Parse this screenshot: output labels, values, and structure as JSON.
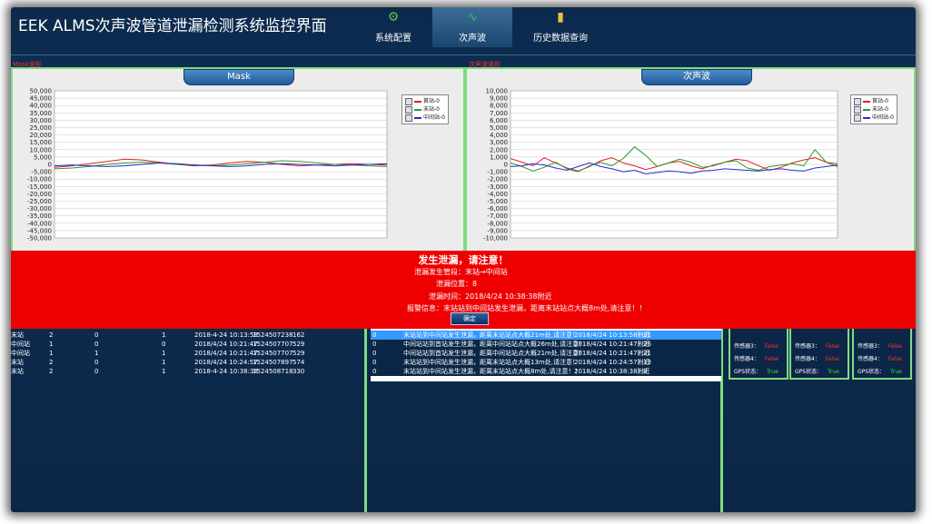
{
  "app": {
    "title": "EEK ALMS次声波管道泄漏检测系统监控界面"
  },
  "nav": [
    {
      "label": "系统配置",
      "icon": "gear-icon",
      "glyph": "⚙",
      "color": "#5bc24a",
      "active": false
    },
    {
      "label": "次声波",
      "icon": "waveform-icon",
      "glyph": "∿",
      "color": "#49b36a",
      "active": true
    },
    {
      "label": "历史数据查询",
      "icon": "database-icon",
      "glyph": "▮",
      "color": "#e8c33b",
      "active": false
    }
  ],
  "left_panel": {
    "section_label": "Mask波形",
    "tab": "Mask"
  },
  "right_panel": {
    "section_label": "次声波波形",
    "tab": "次声波"
  },
  "legend": [
    "首站-0",
    "末站-0",
    "中间站-0"
  ],
  "colors": {
    "series1": "#e02020",
    "series2": "#2b9b2b",
    "series3": "#2a2acd",
    "alarm": "#ee0000",
    "accent": "#7fdc7f"
  },
  "chart_data": [
    {
      "type": "line",
      "title": "Mask",
      "ylim": [
        -50000,
        50000
      ],
      "yticks": [
        "50,000",
        "45,000",
        "40,000",
        "35,000",
        "30,000",
        "25,000",
        "20,000",
        "15,000",
        "10,000",
        "5,000",
        "0",
        "-5,000",
        "-10,000",
        "-15,000",
        "-20,000",
        "-25,000",
        "-30,000",
        "-35,000",
        "-40,000",
        "-45,000",
        "-50,000"
      ],
      "grid": true,
      "legend_position": "top-right",
      "series": [
        {
          "name": "首站-0",
          "values": [
            -2000,
            -1000,
            500,
            2000,
            3500,
            3000,
            1500,
            0,
            -1000,
            -500,
            1000,
            2000,
            1500,
            0,
            -1000,
            -500,
            0,
            500,
            0,
            -500
          ]
        },
        {
          "name": "末站-0",
          "values": [
            -3000,
            -2500,
            -1500,
            0,
            1000,
            1500,
            1000,
            0,
            -500,
            -1000,
            -500,
            500,
            1500,
            2500,
            2000,
            1000,
            0,
            -500,
            -1000,
            -1500
          ]
        },
        {
          "name": "中间站-0",
          "values": [
            -1000,
            -500,
            -1000,
            -1500,
            -1000,
            0,
            1000,
            500,
            -500,
            -1000,
            -1500,
            -1000,
            0,
            500,
            0,
            -500,
            -1000,
            -500,
            0,
            500
          ]
        }
      ]
    },
    {
      "type": "line",
      "title": "次声波",
      "ylim": [
        -10000,
        10000
      ],
      "yticks": [
        "10,000",
        "9,000",
        "8,000",
        "7,000",
        "6,000",
        "5,000",
        "4,000",
        "3,000",
        "2,000",
        "1,000",
        "0",
        "-1,000",
        "-2,000",
        "-3,000",
        "-4,000",
        "-5,000",
        "-6,000",
        "-7,000",
        "-8,000",
        "-9,000",
        "-10,000"
      ],
      "grid": true,
      "legend_position": "top-right",
      "series": [
        {
          "name": "首站-0",
          "values": [
            800,
            300,
            -200,
            900,
            200,
            -500,
            -900,
            -300,
            500,
            900,
            200,
            -200,
            -700,
            -300,
            200,
            400,
            -200,
            -600,
            -100,
            300,
            700,
            500,
            -200,
            -800,
            -400,
            200,
            600,
            900,
            300,
            -300
          ]
        },
        {
          "name": "末站-0",
          "values": [
            200,
            -300,
            -900,
            -400,
            300,
            -600,
            -1000,
            -200,
            300,
            -200,
            800,
            2400,
            1200,
            -300,
            200,
            700,
            300,
            -400,
            -200,
            300,
            500,
            -500,
            -800,
            -300,
            -100,
            100,
            -200,
            2000,
            300,
            100
          ]
        },
        {
          "name": "中间站-0",
          "values": [
            -300,
            -200,
            100,
            -100,
            -500,
            -800,
            -300,
            200,
            -300,
            -600,
            -1000,
            -800,
            -1300,
            -1100,
            -900,
            -1000,
            -1200,
            -900,
            -800,
            -600,
            -700,
            -800,
            -900,
            -700,
            -600,
            -800,
            -900,
            -500,
            -300,
            -100
          ]
        }
      ]
    }
  ],
  "alarm": {
    "title": "发生泄漏，请注意！",
    "pipeline": "泄漏发生管段：末站→中间站",
    "position": "泄漏位置：8",
    "time": "泄漏时间：2018/4/24 10:38:38附近",
    "message": "报警信息：末站站到中间站发生泄漏，距离末站站点大概8m处,请注意！！",
    "ok_label": "确定"
  },
  "left_table": {
    "rows": [
      [
        "末站",
        "2",
        "0",
        "1",
        "2018-4-24 10:13:58",
        "1524507238",
        "162"
      ],
      [
        "中间站",
        "1",
        "0",
        "0",
        "2018/4/24 10:21:47",
        "1524507707",
        "529"
      ],
      [
        "中间站",
        "1",
        "1",
        "1",
        "2018/4/24 10:21:47",
        "1524507707",
        "529"
      ],
      [
        "末站",
        "2",
        "0",
        "1",
        "2018/4/24 10:24:57",
        "1524507897",
        "574"
      ],
      [
        "末站",
        "2",
        "0",
        "1",
        "2018-4-24 10:38:38",
        "1524508718",
        "330"
      ]
    ]
  },
  "middle_list": {
    "rows": [
      {
        "c0": "0",
        "msg": "末站站到中间站发生泄漏，距离末站站点大概21m处,请注意！",
        "time": "2018/4/24 10:13:58附近",
        "n": "21",
        "selected": true
      },
      {
        "c0": "0",
        "msg": "中间站站到首站发生泄漏，距离中间站站点大概26m处,请注意！",
        "time": "2018/4/24 10:21:47附近",
        "n": "26",
        "selected": false
      },
      {
        "c0": "0",
        "msg": "中间站站到首站发生泄漏，距离中间站站点大概21m处,请注意！",
        "time": "2018/4/24 10:21:47附近",
        "n": "21",
        "selected": false
      },
      {
        "c0": "0",
        "msg": "末站站到中间站发生泄漏，距离末站站点大概13m处,请注意！",
        "time": "2018/4/24 10:24:57附近",
        "n": "13",
        "selected": false
      },
      {
        "c0": "0",
        "msg": "末站站到中间站发生泄漏，距离末站站点大概8m处,请注意！！",
        "time": "2018/4/24 10:38:38附近",
        "n": "8",
        "selected": false
      }
    ]
  },
  "sensors": [
    {
      "rows": [
        {
          "label": "传感器3：",
          "value": "False",
          "color": "#ff3333"
        },
        {
          "label": "传感器4：",
          "value": "False",
          "color": "#ff3333"
        },
        {
          "label": "GPS状态：",
          "value": "True",
          "color": "#33dd33"
        }
      ]
    },
    {
      "rows": [
        {
          "label": "传感器3：",
          "value": "False",
          "color": "#ff3333"
        },
        {
          "label": "传感器4：",
          "value": "False",
          "color": "#ff3333"
        },
        {
          "label": "GPS状态：",
          "value": "True",
          "color": "#33dd33"
        }
      ]
    },
    {
      "rows": [
        {
          "label": "传感器3：",
          "value": "False",
          "color": "#ff3333"
        },
        {
          "label": "传感器4：",
          "value": "False",
          "color": "#ff3333"
        },
        {
          "label": "GPS状态：",
          "value": "True",
          "color": "#33dd33"
        }
      ]
    }
  ]
}
